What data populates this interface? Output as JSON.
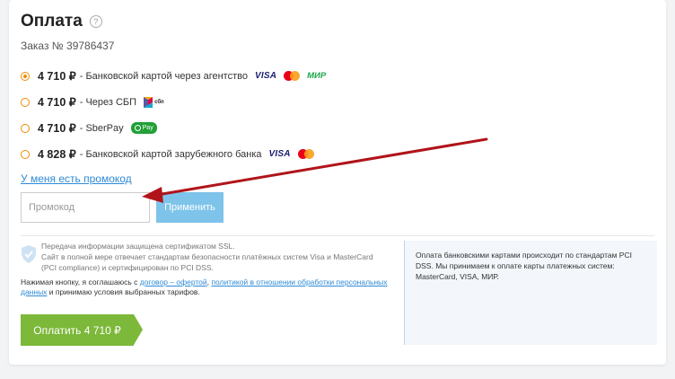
{
  "header": {
    "title": "Оплата",
    "help_icon": "?"
  },
  "order": {
    "label": "Заказ № 39786437"
  },
  "payment_options": [
    {
      "price": "4 710 ₽",
      "desc": "- Банковской картой через агентство",
      "selected": true
    },
    {
      "price": "4 710 ₽",
      "desc": "- Через СБП",
      "selected": false
    },
    {
      "price": "4 710 ₽",
      "desc": "- SberPay",
      "selected": false
    },
    {
      "price": "4 828 ₽",
      "desc": "- Банковской картой зарубежного банка",
      "selected": false
    }
  ],
  "logos": {
    "visa": "VISA",
    "mir": "МИР",
    "sbp": "сбп",
    "sberpay": "Pay"
  },
  "promo": {
    "link_text": "У меня есть промокод",
    "placeholder": "Промокод",
    "apply_label": "Применить"
  },
  "security": {
    "line1": "Передача информации защищена сертификатом SSL.",
    "line2": "Сайт в полной мере отвечает стандартам безопасности платёжных систем Visa и MasterCard",
    "line3": "(PCI compliance) и сертифицирован по PCI DSS."
  },
  "consent": {
    "prefix": "Нажимая кнопку, я соглашаюсь с ",
    "offer_link": "договор – офертой",
    "middle": ", ",
    "policy_link": "политикой в отношении обработки персональных данных",
    "suffix": " и принимаю условия выбранных тарифов."
  },
  "pay_button": {
    "label": "Оплатить 4 710 ₽"
  },
  "info_panel": {
    "text": "Оплата банковскими картами происходит по стандартам PCI DSS. Мы принимаем к оплате карты платежных систем: MasterCard, VISA, МИР."
  },
  "colors": {
    "accent_orange": "#f08c00",
    "link_blue": "#2e8bd6",
    "apply_button": "#7ec3ea",
    "pay_button": "#7cb83a",
    "annotation_red": "#b0141a"
  }
}
